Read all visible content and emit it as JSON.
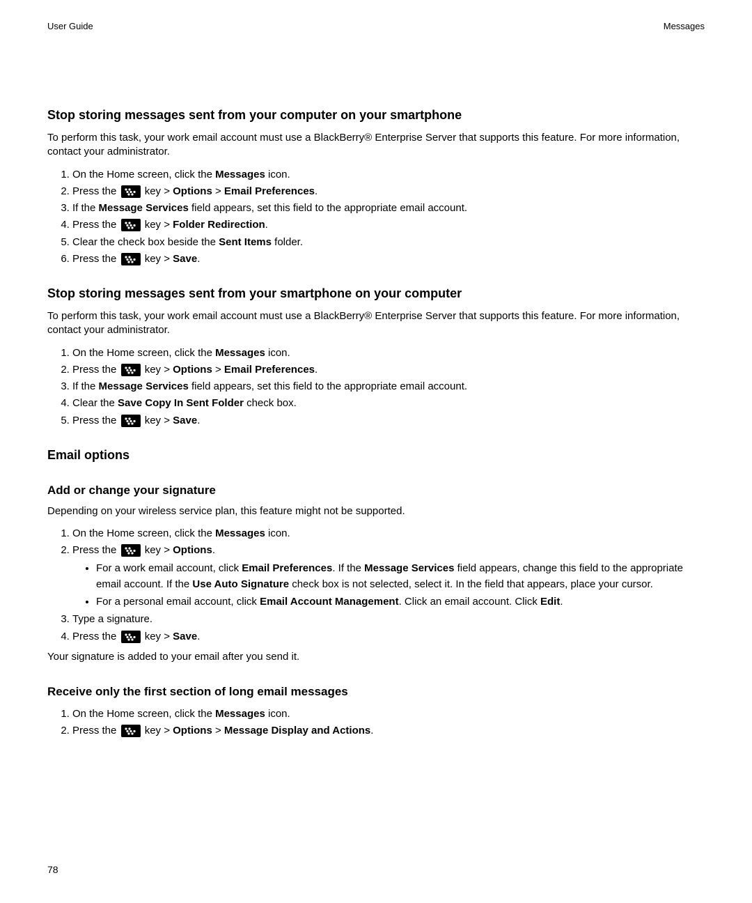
{
  "header": {
    "left": "User Guide",
    "right": "Messages"
  },
  "page_number": "78",
  "icons": {
    "bb_key": "blackberry-menu-key-icon"
  },
  "common": {
    "press_the": "Press the ",
    "key_gt": " key > ",
    "save": "Save",
    "options": "Options",
    "email_prefs": "Email Preferences",
    "folder_redirection": "Folder Redirection",
    "home_pre": "On the Home screen, click the ",
    "messages": "Messages",
    "icon_dot": " icon."
  },
  "s1": {
    "title": "Stop storing messages sent from your computer on your smartphone",
    "intro": "To perform this task, your work email account must use a BlackBerry® Enterprise Server that supports this feature. For more information, contact your administrator.",
    "step3_pre": "If the ",
    "step3_b": "Message Services",
    "step3_post": " field appears, set this field to the appropriate email account.",
    "step5_pre": "Clear the check box beside the ",
    "step5_b": "Sent Items",
    "step5_post": " folder."
  },
  "s2": {
    "title": "Stop storing messages sent from your smartphone on your computer",
    "intro": "To perform this task, your work email account must use a BlackBerry® Enterprise Server that supports this feature. For more information, contact your administrator.",
    "step3_pre": "If the ",
    "step3_b": "Message Services",
    "step3_post": " field appears, set this field to the appropriate email account.",
    "step4_pre": "Clear the ",
    "step4_b": "Save Copy In Sent Folder",
    "step4_post": " check box."
  },
  "s3": {
    "title": "Email options"
  },
  "s4": {
    "title": "Add or change your signature",
    "intro": "Depending on your wireless service plan, this feature might not be supported.",
    "b1_pre": "For a work email account, click ",
    "b1_b1": "Email Preferences",
    "b1_mid1": ". If the ",
    "b1_b2": "Message Services",
    "b1_mid2": " field appears, change this field to the appropriate email account. If the ",
    "b1_b3": "Use Auto Signature",
    "b1_post": " check box is not selected, select it. In the field that appears, place your cursor.",
    "b2_pre": "For a personal email account, click ",
    "b2_b1": "Email Account Management",
    "b2_mid": ". Click an email account. Click ",
    "b2_b2": "Edit",
    "step3": "Type a signature.",
    "after": "Your signature is added to your email after you send it."
  },
  "s5": {
    "title": "Receive only the first section of long email messages",
    "step2_b": "Message Display and Actions"
  }
}
